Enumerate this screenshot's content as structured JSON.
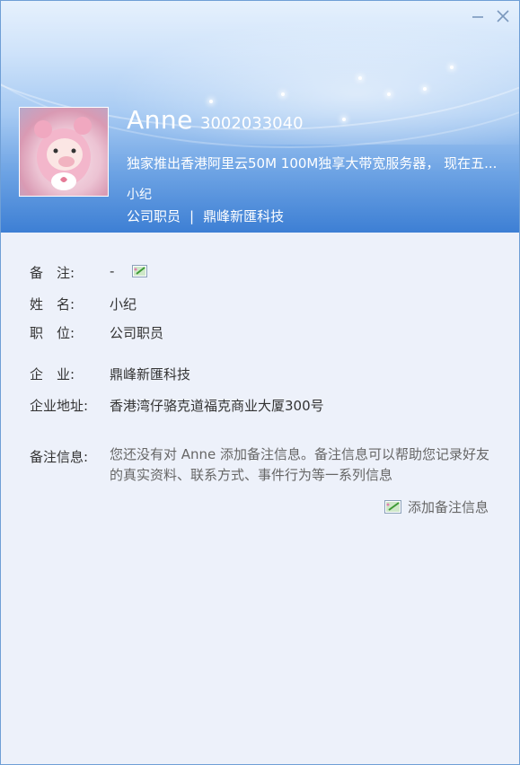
{
  "window": {
    "minimize_icon": "minimize-icon",
    "close_icon": "close-icon"
  },
  "profile": {
    "display_name": "Anne",
    "account_id": "3002033040",
    "signature": "独家推出香港阿里云50M 100M独享大带宽服务器， 现在五...",
    "nickname": "小纪",
    "job_title": "公司职员",
    "separator": "|",
    "company": "鼎峰新匯科技"
  },
  "details": {
    "remark_label": "备　注:",
    "remark_value": "-",
    "name_label": "姓　名:",
    "name_value": "小纪",
    "position_label": "职　位:",
    "position_value": "公司职员",
    "company_label": "企　业:",
    "company_value": "鼎峰新匯科技",
    "address_label": "企业地址:",
    "address_value": "香港湾仔骆克道福克商业大厦300号",
    "notes_label": "备注信息:",
    "notes_text": "您还没有对 Anne 添加备注信息。备注信息可以帮助您记录好友的真实资料、联系方式、事件行为等一系列信息",
    "add_notes_label": "添加备注信息"
  },
  "colors": {
    "header_top": "#e6f1fd",
    "header_bottom": "#3d7fd4",
    "panel_background": "#edf1fa"
  }
}
